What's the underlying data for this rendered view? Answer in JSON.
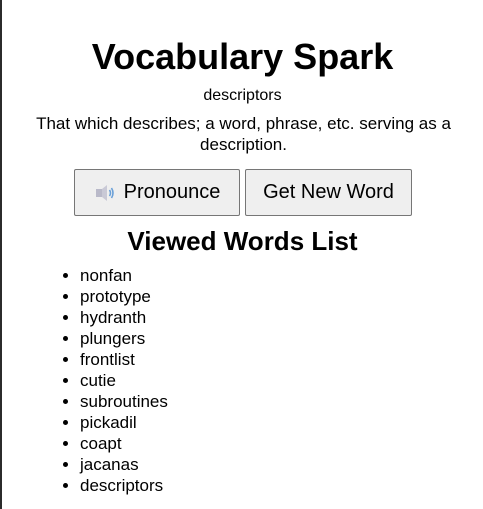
{
  "app": {
    "title": "Vocabulary Spark",
    "current_word": "descriptors",
    "definition": "That which describes; a word, phrase, etc. serving as a description."
  },
  "buttons": {
    "pronounce_label": "Pronounce",
    "pronounce_icon": "speaker-icon",
    "new_word_label": "Get New Word"
  },
  "viewed": {
    "title": "Viewed Words List",
    "words": [
      "nonfan",
      "prototype",
      "hydranth",
      "plungers",
      "frontlist",
      "cutie",
      "subroutines",
      "pickadil",
      "coapt",
      "jacanas",
      "descriptors"
    ]
  }
}
